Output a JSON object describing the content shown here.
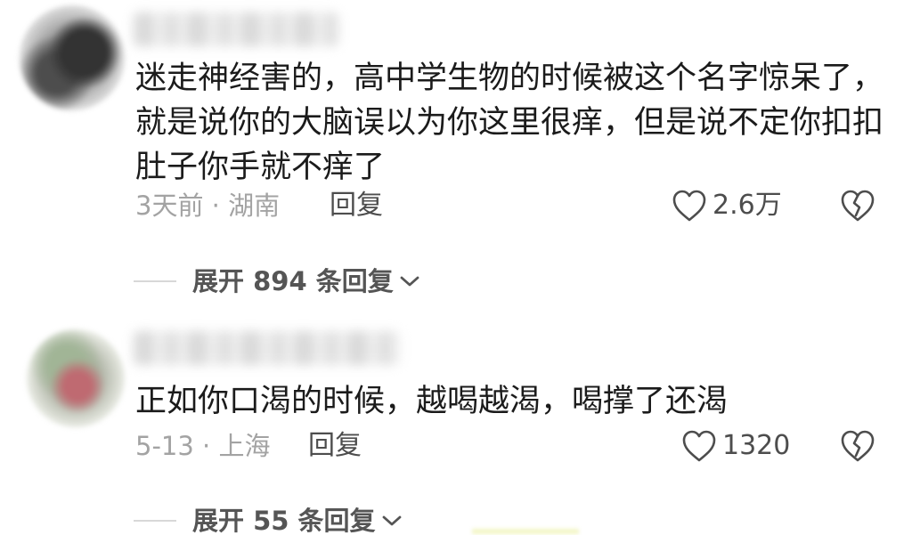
{
  "comments": [
    {
      "text": "迷走神经害的，高中学生物的时候被这个名字惊呆了，就是说你的大脑误以为你这里很痒，但是说不定你扣扣肚子你手就不痒了",
      "meta": "3天前 · 湖南",
      "reply_label": "回复",
      "likes": "2.6万",
      "expand_label": "展开 894 条回复"
    },
    {
      "text": "正如你口渴的时候，越喝越渴，喝撑了还渴",
      "meta": "5-13 · 上海",
      "reply_label": "回复",
      "likes": "1320",
      "expand_label": "展开 55 条回复"
    }
  ],
  "icons": {
    "like": "heart-outline-icon",
    "dislike": "broken-heart-icon",
    "expand": "chevron-down-icon"
  },
  "colors": {
    "text": "#1b1b1b",
    "meta": "#a3a3a3",
    "action": "#4d4d4d",
    "expand": "#555555"
  }
}
